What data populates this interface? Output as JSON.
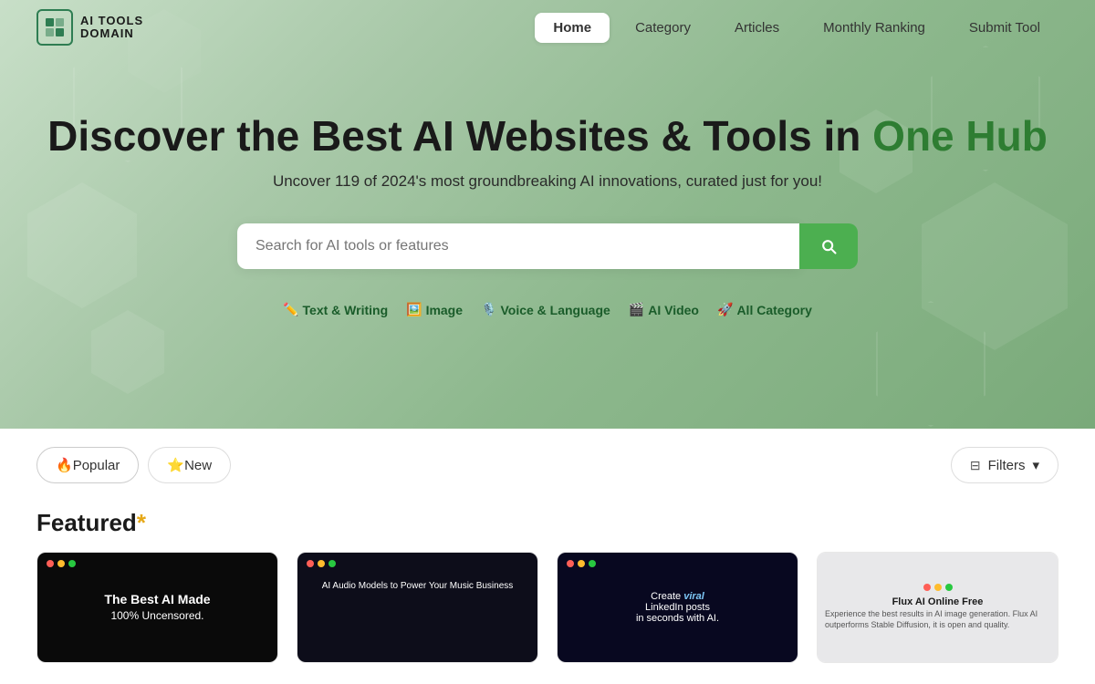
{
  "brand": {
    "line1": "AI TOOLS",
    "line2": "DOMAIN"
  },
  "nav": {
    "links": [
      {
        "id": "home",
        "label": "Home",
        "active": true
      },
      {
        "id": "category",
        "label": "Category",
        "active": false
      },
      {
        "id": "articles",
        "label": "Articles",
        "active": false
      },
      {
        "id": "monthly-ranking",
        "label": "Monthly Ranking",
        "active": false
      },
      {
        "id": "submit-tool",
        "label": "Submit Tool",
        "active": false
      }
    ]
  },
  "hero": {
    "title_part1": "Discover the Best AI Websites & Tools in ",
    "title_highlight": "One Hub",
    "subtitle_part1": "Uncover 119 of 2024's most groundbreaking AI innovations, ",
    "subtitle_part2": "curated just for you!",
    "search_placeholder": "Search for AI tools or features"
  },
  "categories": [
    {
      "id": "text-writing",
      "emoji": "✏️",
      "label": "Text & Writing"
    },
    {
      "id": "image",
      "emoji": "🖼️",
      "label": "Image"
    },
    {
      "id": "voice-language",
      "emoji": "🎙️",
      "label": "Voice & Language"
    },
    {
      "id": "ai-video",
      "emoji": "🎬",
      "label": "AI Video"
    },
    {
      "id": "all-category",
      "emoji": "🚀",
      "label": "All Category"
    }
  ],
  "tabs": [
    {
      "id": "popular",
      "emoji": "🔥",
      "label": "Popular",
      "active": true
    },
    {
      "id": "new",
      "emoji": "⭐",
      "label": "New",
      "active": false
    }
  ],
  "filters_label": "Filters",
  "featured_title": "Featured",
  "featured_star": "*",
  "cards": [
    {
      "id": "card-1",
      "thumb_text_main": "The Best AI Made",
      "thumb_text_sub": "100% Uncensored."
    },
    {
      "id": "card-2",
      "thumb_text_main": "AI Audio Models to Power Your Music Business"
    },
    {
      "id": "card-3",
      "thumb_text_line1": "Create",
      "thumb_text_viral": "viral",
      "thumb_text_line2": "LinkedIn posts",
      "thumb_text_line3": "in seconds with AI."
    },
    {
      "id": "card-4",
      "thumb_brand": "Flux AI Online Free",
      "thumb_sub": "Experience the best results in AI image generation. Flux AI outperforms Stable Diffusion, it is open and quality."
    }
  ]
}
